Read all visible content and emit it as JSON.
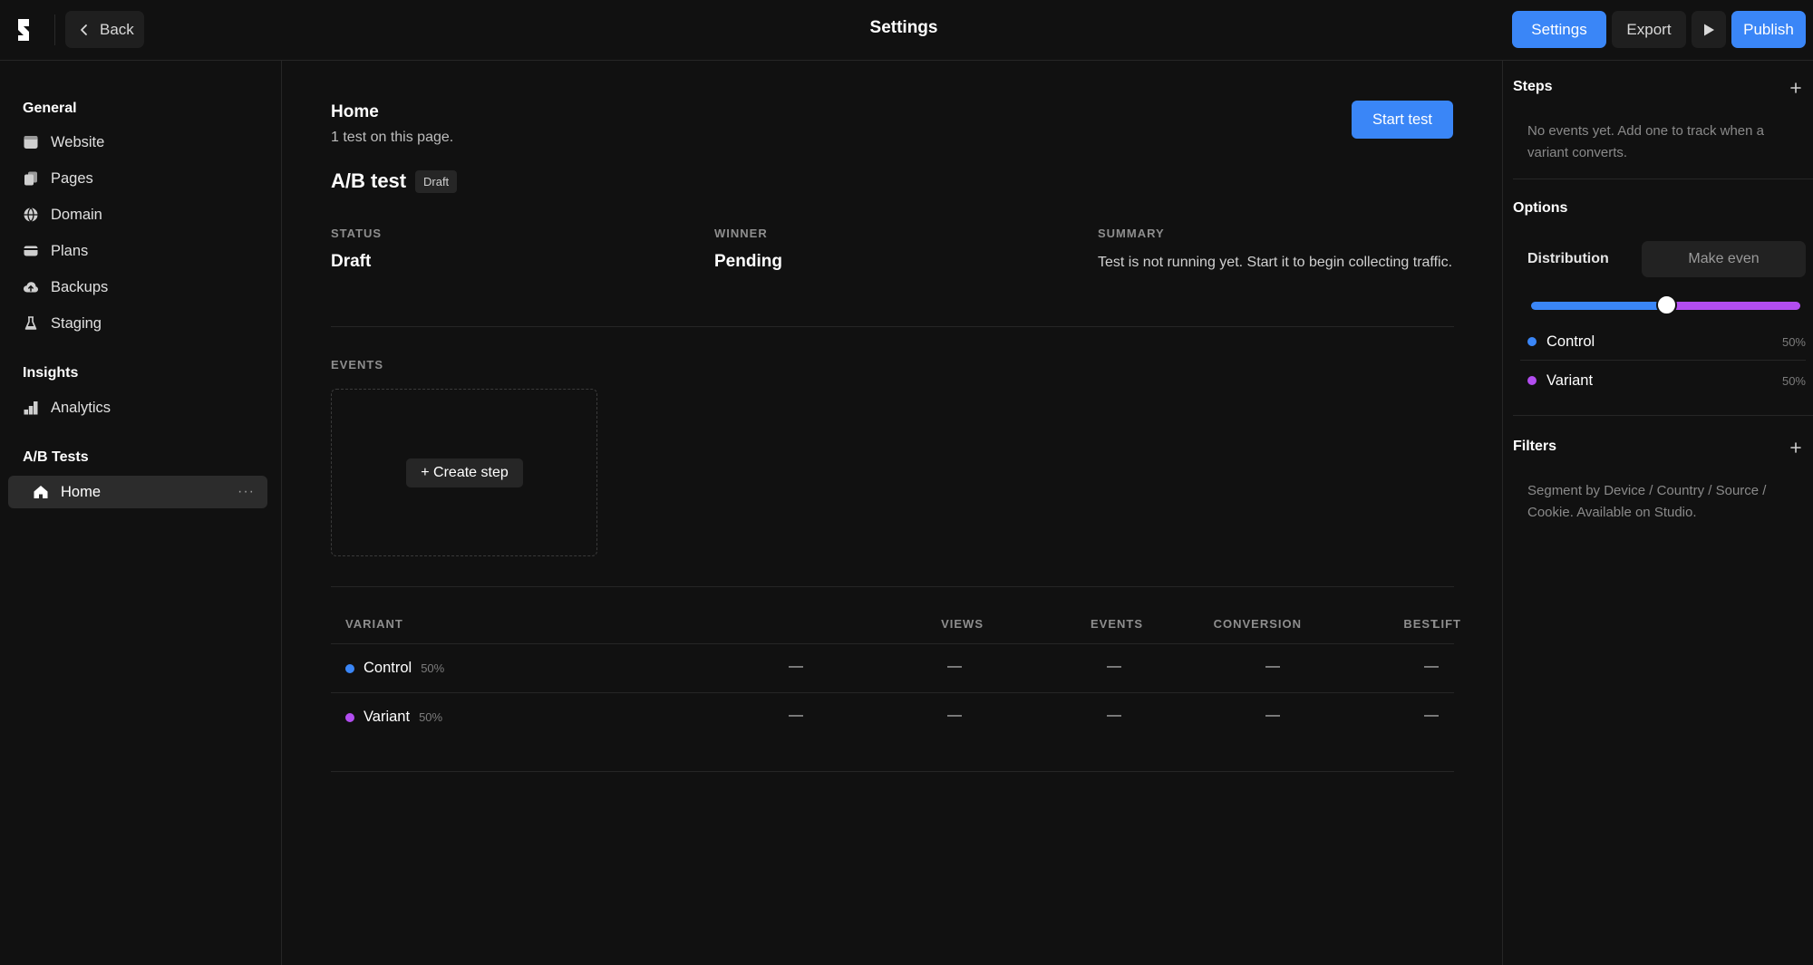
{
  "topbar": {
    "back_label": "Back",
    "title": "Settings",
    "settings_label": "Settings",
    "export_label": "Export",
    "publish_label": "Publish"
  },
  "sidebar": {
    "general_title": "General",
    "general_items": [
      {
        "label": "Website",
        "icon": "browser-icon"
      },
      {
        "label": "Pages",
        "icon": "pages-icon"
      },
      {
        "label": "Domain",
        "icon": "globe-icon"
      },
      {
        "label": "Plans",
        "icon": "card-icon"
      },
      {
        "label": "Backups",
        "icon": "cloud-upload-icon"
      },
      {
        "label": "Staging",
        "icon": "flask-icon"
      }
    ],
    "insights_title": "Insights",
    "insights_items": [
      {
        "label": "Analytics",
        "icon": "chart-icon"
      }
    ],
    "abtests_title": "A/B Tests",
    "abtests_items": [
      {
        "label": "Home",
        "icon": "home-icon",
        "more": "···"
      }
    ]
  },
  "main": {
    "page_name": "Home",
    "page_sub": "1 test on this page.",
    "start_label": "Start test",
    "test_title": "A/B test",
    "badge": "Draft",
    "status_label": "STATUS",
    "status_value": "Draft",
    "winner_label": "WINNER",
    "winner_value": "Pending",
    "summary_label": "SUMMARY",
    "summary_value": "Test is not running yet. Start it to begin collecting traffic.",
    "events_label": "EVENTS",
    "create_step_label": "+ Create step",
    "table": {
      "headers": [
        "VARIANT",
        "VIEWS",
        "EVENTS",
        "CONVERSION",
        "LIFT",
        "BEST"
      ],
      "rows": [
        {
          "name": "Control",
          "pct": "50%",
          "color": "#3a86f7",
          "cells": [
            "—",
            "—",
            "—",
            "—",
            "—"
          ]
        },
        {
          "name": "Variant",
          "pct": "50%",
          "color": "#b24df0",
          "cells": [
            "—",
            "—",
            "—",
            "—",
            "—"
          ]
        }
      ]
    }
  },
  "right": {
    "steps_title": "Steps",
    "steps_note": "No events yet. Add one to track when a variant converts.",
    "options_title": "Options",
    "distribution_label": "Distribution",
    "make_even_label": "Make even",
    "distribution_split": 0.5,
    "variants": [
      {
        "name": "Control",
        "pct": "50%",
        "color": "#3a86f7"
      },
      {
        "name": "Variant",
        "pct": "50%",
        "color": "#b24df0"
      }
    ],
    "filters_title": "Filters",
    "filters_note": "Segment by Device / Country / Source / Cookie. Available on Studio."
  },
  "colors": {
    "accent": "#3a86f7",
    "variant": "#b24df0",
    "background": "#111111"
  }
}
